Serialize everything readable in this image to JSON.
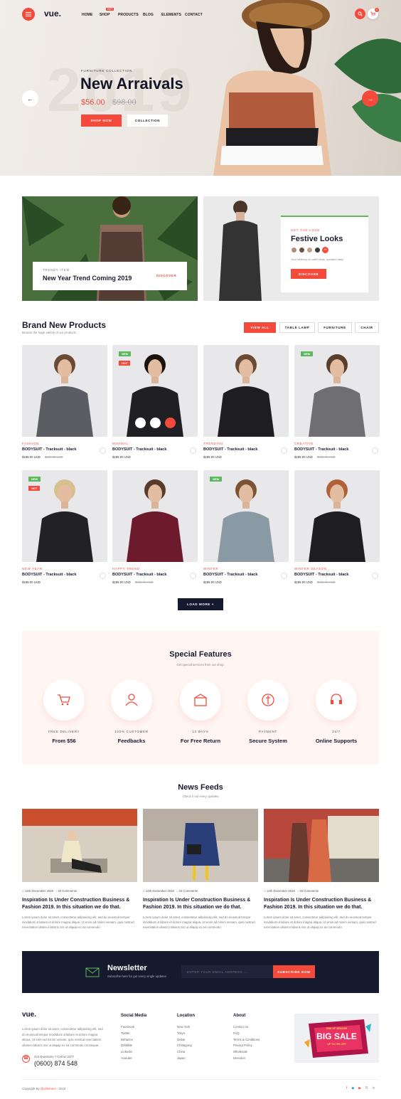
{
  "header": {
    "logo": "vue.",
    "nav": [
      "HOME",
      "SHOP",
      "PRODUCTS",
      "BLOG",
      "ELEMENTS",
      "CONTACT"
    ],
    "shop_badge": "HOT",
    "cart_count": "0"
  },
  "hero": {
    "eyebrow": "FURNITURE COLLECTION",
    "bg_year": "2019",
    "title": "New Arraivals",
    "price": "$56.00",
    "old_price": "$98.00",
    "btn_primary": "SHOP NOW",
    "btn_secondary": "COLLECTION"
  },
  "promo_left": {
    "eyebrow": "TRENDY ITEM",
    "title": "New Year Trend Coming 2019",
    "cta": "DISCOVER"
  },
  "promo_right": {
    "eyebrow": "GET THE LOOK",
    "title": "Festive Looks",
    "more": "+6",
    "desc": "Your delivery of outfit ideas, updated daily.",
    "cta": "DISCOVER"
  },
  "products": {
    "title": "Brand New Products",
    "subtitle": "Browse the huge variety of our products",
    "filters": [
      "VIEW ALL",
      "TABLE LAMP",
      "FURNITURE",
      "CHAIR"
    ],
    "items": [
      {
        "cat": "FASHION",
        "name": "BODYSUIT - Tracksuit - black",
        "price": "$199.00 USD",
        "old": "$230.00 USD",
        "badges": []
      },
      {
        "cat": "MINIMAL",
        "name": "BODYSUIT - Tracksuit - black",
        "price": "$199.00 USD",
        "old": "",
        "badges": [
          "NEW",
          "HOT"
        ]
      },
      {
        "cat": "TRENDING",
        "name": "BODYSUIT - Tracksuit - black",
        "price": "$199.00 USD",
        "old": "",
        "badges": []
      },
      {
        "cat": "CREATIVE",
        "name": "BODYSUIT - Tracksuit - black",
        "price": "$199.00 USD",
        "old": "$230.00 USD",
        "badges": [
          "NEW"
        ]
      },
      {
        "cat": "NEW YEAR",
        "name": "BODYSUIT - Tracksuit - black",
        "price": "$199.00 USD",
        "old": "",
        "badges": [
          "NEW",
          "HOT"
        ]
      },
      {
        "cat": "HAPPY TREND",
        "name": "BODYSUIT - Tracksuit - black",
        "price": "$199.00 USD",
        "old": "$230.00 USD",
        "badges": []
      },
      {
        "cat": "WINTER",
        "name": "BODYSUIT - Tracksuit - black",
        "price": "$199.00 USD",
        "old": "",
        "badges": [
          "NEW"
        ]
      },
      {
        "cat": "WINTER SEASON",
        "name": "BODYSUIT - Tracksuit - black",
        "price": "$199.00 USD",
        "old": "$230.00 USD",
        "badges": []
      }
    ],
    "load_more": "LOAD MORE  +"
  },
  "features": {
    "title": "Special Features",
    "subtitle": "Get special services from our shop.",
    "items": [
      {
        "t1": "FREE DELIVERY",
        "t2": "From $56",
        "icon": "cart-icon"
      },
      {
        "t1": "100% CUSTOMER",
        "t2": "Feedbacks",
        "icon": "customer-icon"
      },
      {
        "t1": "10 DAYS",
        "t2": "For Free Return",
        "icon": "return-box-icon"
      },
      {
        "t1": "PAYMENT",
        "t2": "Secure System",
        "icon": "payment-icon"
      },
      {
        "t1": "24/7",
        "t2": "Online Supports",
        "icon": "support-icon"
      }
    ]
  },
  "news": {
    "title": "News Feeds",
    "subtitle": "Check it out every updates",
    "items": [
      {
        "date": "14th December 2018",
        "comments": "33 Comments",
        "title": "Inspiration Is Under Construction Business & Fashion 2019. In this situation we do that.",
        "excerpt": "Lorem ipsum dolor sit amet, consectetur adipisicing elit, sed do eiusmod tempor incididunt ut labore et dolore magna aliqua. Ut enim ad minim veniam, quis nostrud exercitation ullamco laboris nisi ut aliquip ex ea commodo."
      },
      {
        "date": "14th December 2018",
        "comments": "33 Comments",
        "title": "Inspiration Is Under Construction Business & Fashion 2019. In this situation we do that.",
        "excerpt": "Lorem ipsum dolor sit amet, consectetur adipisicing elit, sed do eiusmod tempor incididunt ut labore et dolore magna aliqua. Ut enim ad minim veniam, quis nostrud exercitation ullamco laboris nisi ut aliquip ex ea commodo."
      },
      {
        "date": "14th December 2018",
        "comments": "33 Comments",
        "title": "Inspiration Is Under Construction Business & Fashion 2019. In this situation we do that.",
        "excerpt": "Lorem ipsum dolor sit amet, consectetur adipisicing elit, sed do eiusmod tempor incididunt ut labore et dolore magna aliqua. Ut enim ad minim veniam, quis nostrud exercitation ullamco laboris nisi ut aliquip ex ea commodo."
      }
    ]
  },
  "newsletter": {
    "title": "Newsletter",
    "subtitle": "Subscribe here for get every single updates",
    "placeholder": "ENTER YOUR EMAIL ADDRESS....",
    "button": "SUBSCRIBE NOW"
  },
  "footer": {
    "logo": "vue.",
    "about": "Lorem ipsum dolor sit amet, consectetur adipisicing elit, sed do eiusmod tempor incididunt ut labore et dolore magna aliqua. Ut enim ad minim veniam, quis nostrud exercitation ullamco laboris nisi ut aliquip ex ea commodo consequat.",
    "phone_label": "Got Questions ? Call us 24/7!",
    "phone": "(0600) 874 548",
    "social": {
      "title": "Social Media",
      "links": [
        "Facebook",
        "Twitter",
        "Behance",
        "Dribbble",
        "Linkedin",
        "Youtube"
      ]
    },
    "location": {
      "title": "Location",
      "links": [
        "New York",
        "Tokyo",
        "Dubai",
        "Chittagong",
        "China",
        "Japan"
      ]
    },
    "about_col": {
      "title": "About",
      "links": [
        "Contact Us",
        "FAQ",
        "Terms & Conditions",
        "Privacy Policy",
        "Wholesale",
        "Direction"
      ]
    },
    "sale": {
      "top": "END OF SEASON",
      "main": "BIG SALE",
      "sub": "UP TO 70% OFF"
    },
    "copyright_prefix": "Copyright By ",
    "copyright_brand": "@uithemes",
    "copyright_suffix": " - 2019"
  },
  "colors": {
    "accent": "#f44a3c",
    "dark": "#161a2e",
    "green": "#5cb85c"
  }
}
